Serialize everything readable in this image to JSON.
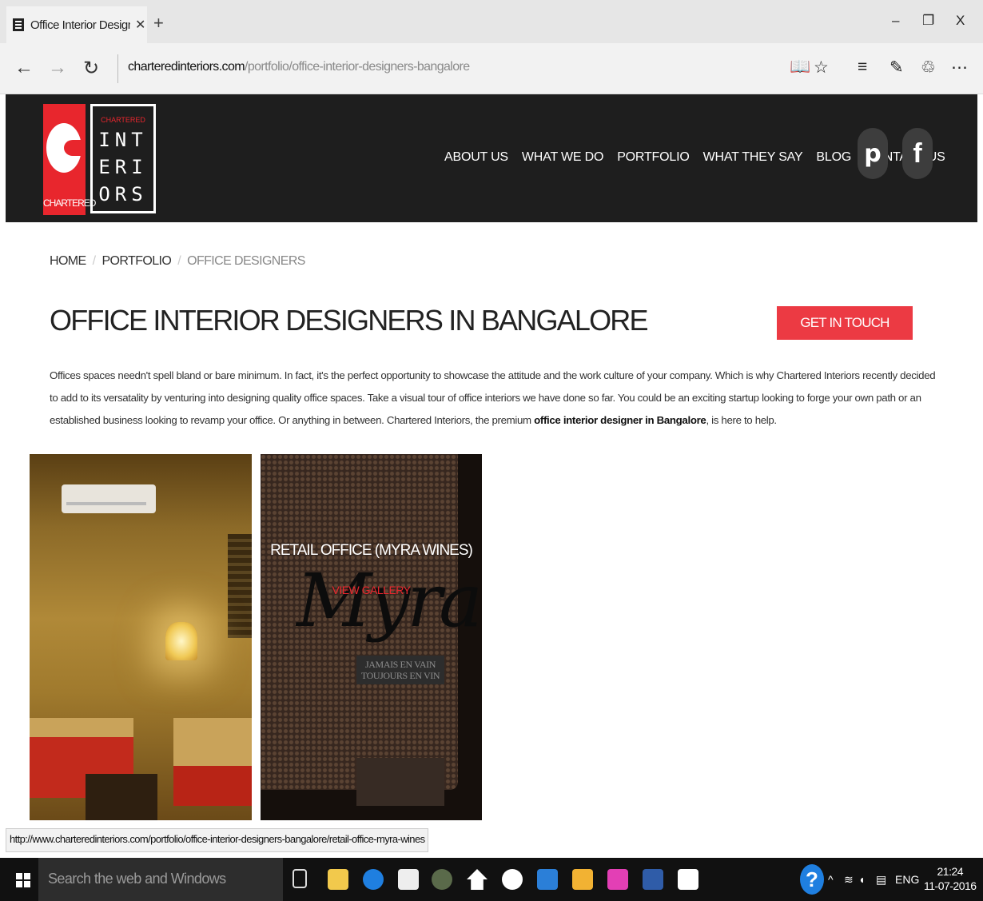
{
  "browser": {
    "tab_title": "Office Interior Designers",
    "tab_close": "✕",
    "new_tab": "+",
    "window_controls": {
      "minimize": "–",
      "restore": "❐",
      "close": "X"
    },
    "nav": {
      "back": "←",
      "forward": "→",
      "refresh": "↻"
    },
    "url_domain": "charteredinteriors.com",
    "url_path": "/portfolio/office-interior-designers-bangalore",
    "tools": {
      "reading_view": "📖",
      "favorite": "☆",
      "hub": "≡",
      "note": "✎",
      "share": "♲",
      "more": "⋯"
    }
  },
  "site": {
    "logo": {
      "small_text": "CHARTERED",
      "left_label": "CHARTERED",
      "lines": [
        "INT",
        "ERI",
        "ORS"
      ]
    },
    "nav": [
      "ABOUT US",
      "WHAT WE DO",
      "PORTFOLIO",
      "WHAT THEY SAY",
      "BLOG",
      "CONTACT US"
    ],
    "social": {
      "pinterest": "𝗽",
      "facebook": "f"
    }
  },
  "breadcrumb": {
    "home": "HOME",
    "portfolio": "PORTFOLIO",
    "current": "OFFICE DESIGNERS",
    "sep": "/"
  },
  "page": {
    "title": "OFFICE INTERIOR DESIGNERS IN BANGALORE",
    "cta": "GET IN TOUCH",
    "intro_before": "Offices spaces needn't spell bland or bare minimum. In fact, it's the perfect opportunity to showcase the attitude and the work culture of your company. Which is why Chartered Interiors recently decided to add to its versatality by venturing into designing quality office spaces. Take a visual tour of office interiors we have done so far. You could be an exciting startup looking to forge your own path or an established business looking to revamp your office. Or anything in between. Chartered Interiors, the premium ",
    "intro_bold": "office interior designer in Bangalore",
    "intro_after": ", is here to help."
  },
  "gallery": {
    "tile2_caption": "RETAIL OFFICE (MYRA WINES)",
    "tile2_view": "VIEW GALLERY",
    "tile2_brand": "Myra",
    "tile2_motto_1": "JAMAIS EN VAIN",
    "tile2_motto_2": "TOUJOURS EN VIN"
  },
  "status_url": "http://www.charteredinteriors.com/portfolio/office-interior-designers-bangalore/retail-office-myra-wines",
  "taskbar": {
    "search_placeholder": "Search the web and Windows",
    "help": "?",
    "tray_caret": "^",
    "tray_lang": "ENG",
    "time": "21:24",
    "date": "11-07-2016"
  }
}
